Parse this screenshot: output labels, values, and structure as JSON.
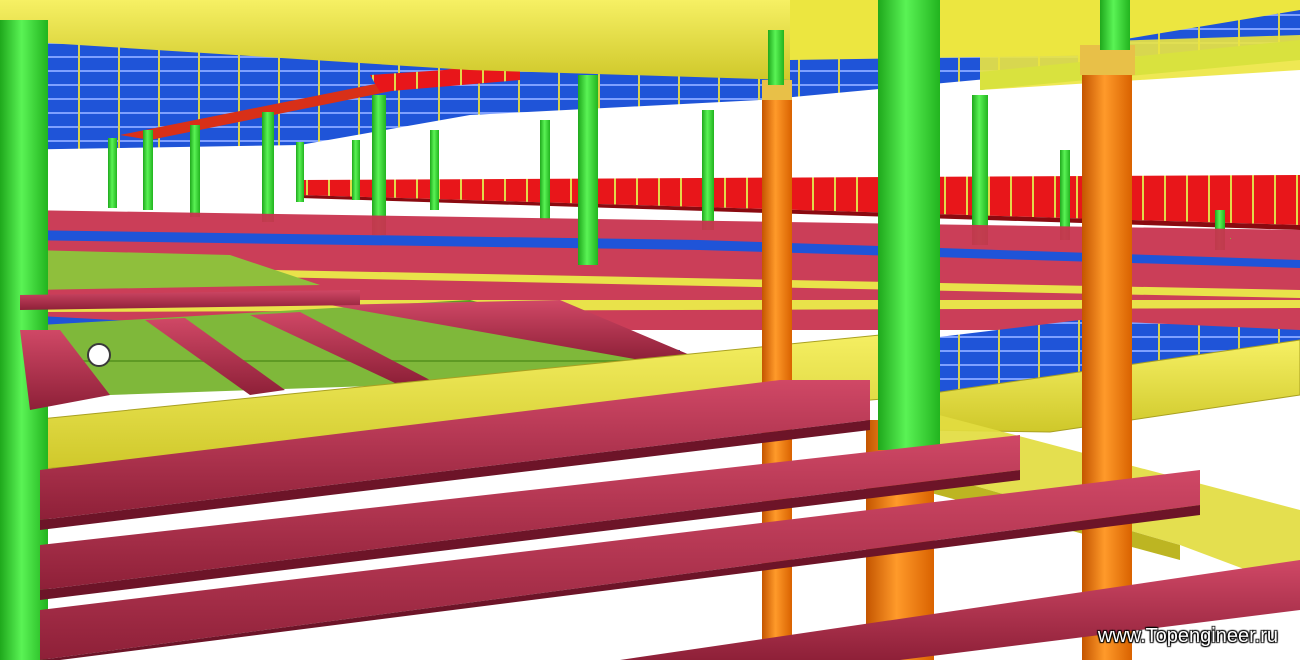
{
  "image": {
    "kind": "3D steel structure model render",
    "watermark_text": "www.Topengineer.ru"
  },
  "palette": {
    "column_green": "#3ee03a",
    "column_orange": "#ff7a10",
    "beam_crimson": "#b8324e",
    "beam_yellow": "#ece640",
    "beam_blue": "#1f54d8",
    "beam_red": "#e8161a",
    "deck_olive": "#7fb83a",
    "background": "#ffffff"
  },
  "icons": [
    "steel-column",
    "steel-beam",
    "floor-deck"
  ]
}
